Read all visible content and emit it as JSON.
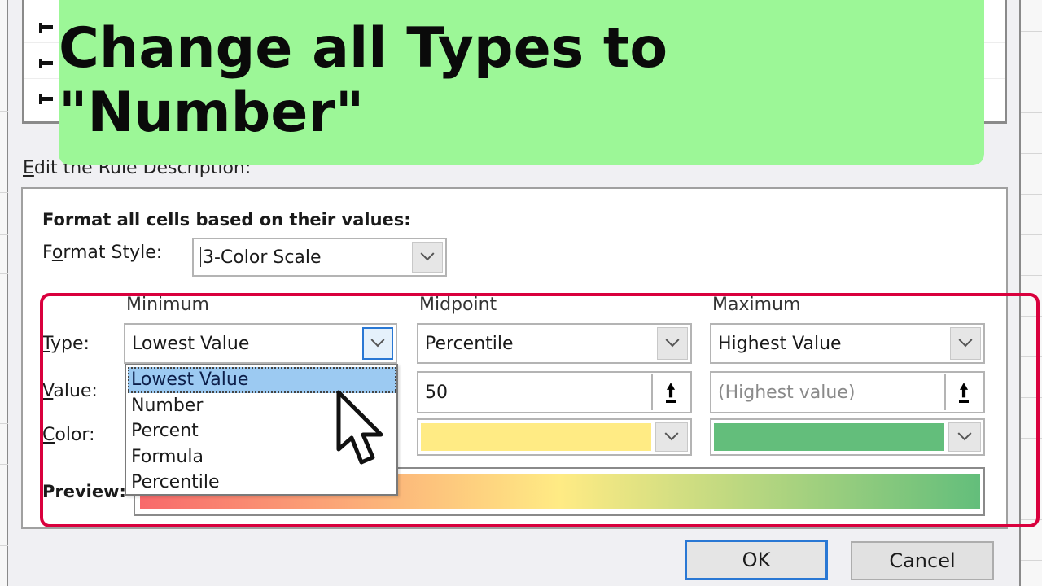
{
  "overlay": {
    "banner_text": "Change all Types to \"Number\""
  },
  "dialog": {
    "section_label_prefix": "E",
    "section_label_rest": "dit the Rule Description:",
    "format_all_label": "Format all cells based on their values:",
    "format_style_label_pre": "F",
    "format_style_label_u": "o",
    "format_style_label_post": "rmat Style:",
    "format_style_value": "3-Color Scale",
    "columns": {
      "minimum": "Minimum",
      "midpoint": "Midpoint",
      "maximum": "Maximum"
    },
    "row_labels": {
      "type_u": "T",
      "type_rest": "ype:",
      "value_u": "V",
      "value_rest": "alue:",
      "color_u": "C",
      "color_rest": "olor:",
      "preview": "Preview:"
    },
    "minimum": {
      "type": "Lowest Value",
      "color": "#f8696b"
    },
    "midpoint": {
      "type": "Percentile",
      "value": "50",
      "color": "#ffeb84"
    },
    "maximum": {
      "type": "Highest Value",
      "value_placeholder": "(Highest value)",
      "color": "#63be7b"
    },
    "type_dropdown": {
      "options": [
        "Lowest Value",
        "Number",
        "Percent",
        "Formula",
        "Percentile"
      ],
      "selected": "Lowest Value"
    },
    "buttons": {
      "ok": "OK",
      "cancel": "Cancel"
    }
  },
  "colors": {
    "highlight_frame": "#d9003d",
    "banner_bg": "#9cf797",
    "focus_blue": "#2a78d4",
    "list_selection": "#9ccaf2"
  }
}
